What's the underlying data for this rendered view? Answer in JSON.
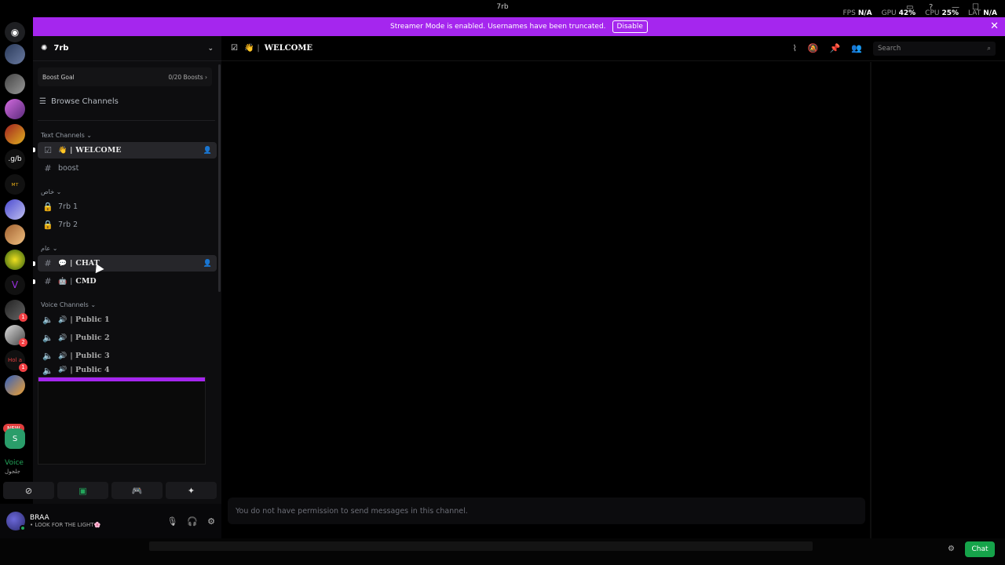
{
  "window": {
    "title": "7rb"
  },
  "perf": {
    "fps_label": "FPS",
    "fps": "N/A",
    "gpu_label": "GPU",
    "gpu": "42%",
    "cpu_label": "CPU",
    "cpu": "25%",
    "lat_label": "LAT",
    "lat": "N/A"
  },
  "banner": {
    "text": "Streamer Mode is enabled. Usernames have been truncated.",
    "disable_label": "Disable",
    "close": "✕"
  },
  "guild_badges": [
    "1",
    "2",
    "1"
  ],
  "new_label": "NEW",
  "server": {
    "name": "7rb",
    "boost_goal": "Boost Goal",
    "boost_progress": "0/20 Boosts ›",
    "browse": "Browse Channels"
  },
  "categories": {
    "text": "Text Channels ⌄",
    "private": "خاص ⌄",
    "public": "عام ⌄",
    "voice": "Voice Channels ⌄"
  },
  "channels": {
    "welcome": {
      "emoji": "👋",
      "sep": "|",
      "name": "WELCOME"
    },
    "boost": {
      "name": "boost"
    },
    "trb1": {
      "name": "7rb 1"
    },
    "trb2": {
      "name": "7rb 2"
    },
    "chat": {
      "emoji": "💬",
      "sep": "|",
      "name": "CHAT"
    },
    "cmd": {
      "emoji": "🤖",
      "sep": "|",
      "name": "CMD"
    },
    "voice": [
      {
        "name": "| Public 1"
      },
      {
        "name": "| Public 2"
      },
      {
        "name": "| Public 3"
      },
      {
        "name": "| Public 4"
      }
    ]
  },
  "voice_connected": {
    "label": "Voice",
    "sub": "جلجول"
  },
  "user": {
    "name": "BRAA",
    "status": "• LOOK FOR THE LIGHT🌸"
  },
  "main": {
    "channel_emoji": "👋",
    "channel_sep": "|",
    "channel_name": "WELCOME",
    "search_placeholder": "Search",
    "composer_text": "You do not have permission to send messages in this channel."
  },
  "taskbar": {
    "chat_label": "Chat"
  },
  "colors": {
    "accent": "#a526ee",
    "online": "#23a55a",
    "chat_button": "#16a34a"
  }
}
